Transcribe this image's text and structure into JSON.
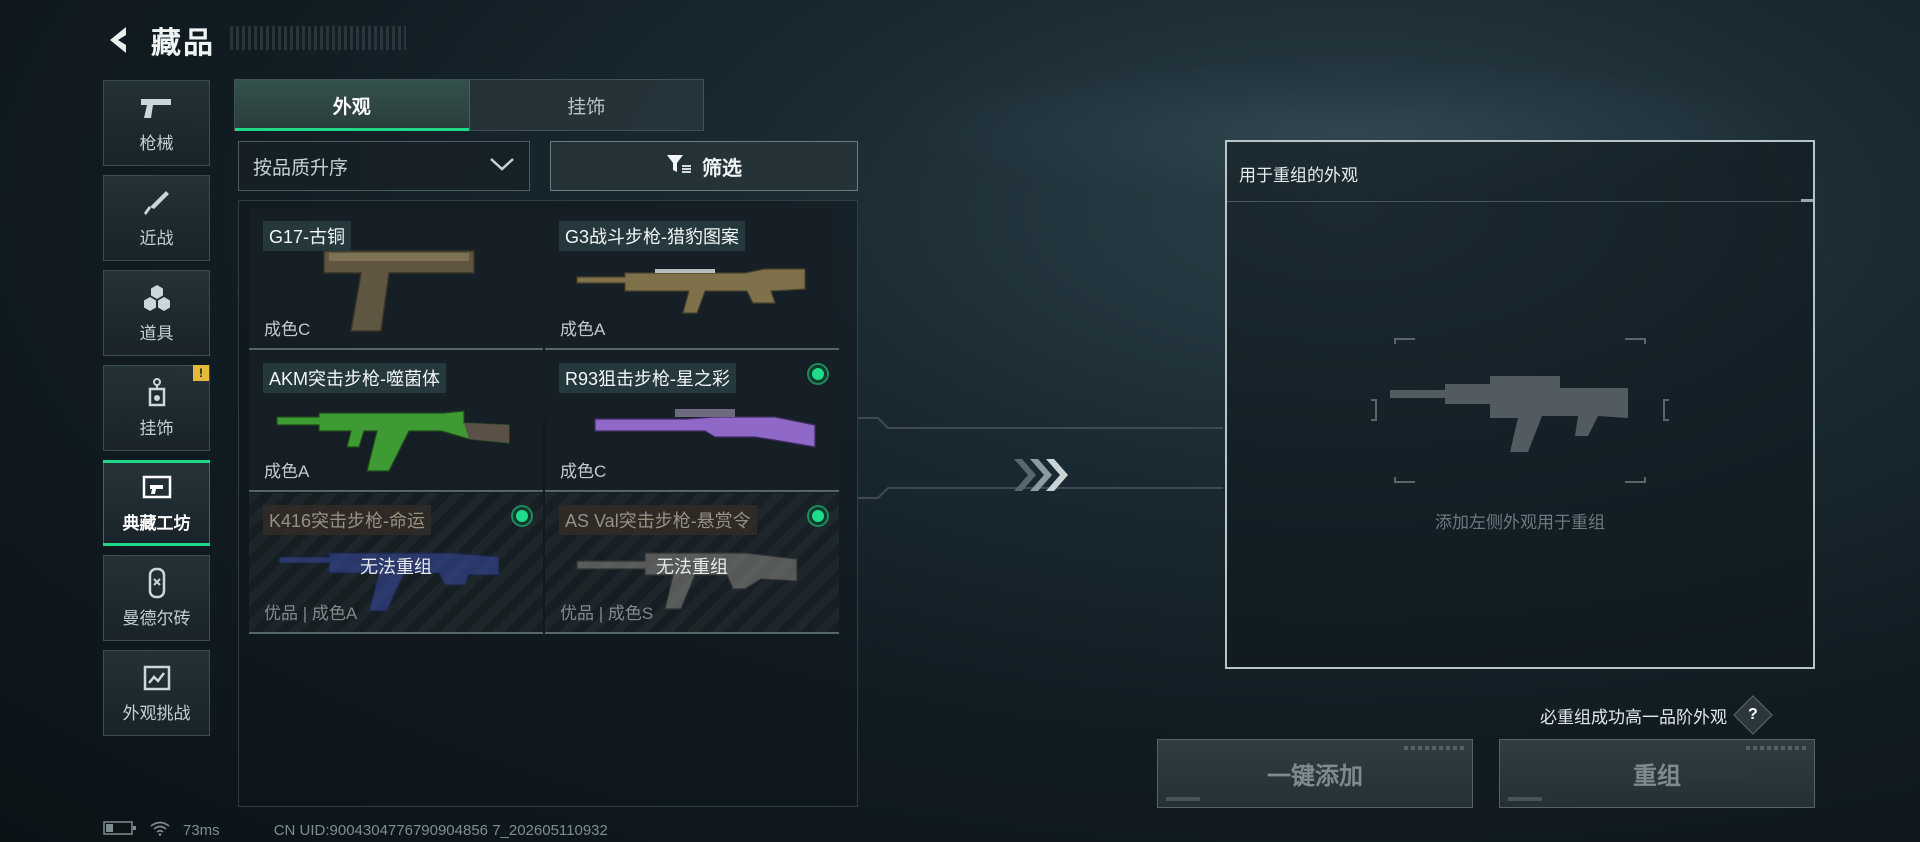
{
  "header": {
    "title": "藏品",
    "back_icon": "back-arrow-icon"
  },
  "categories": [
    {
      "label": "枪械",
      "icon": "pistol-icon",
      "active": false
    },
    {
      "label": "近战",
      "icon": "knife-icon",
      "active": false
    },
    {
      "label": "道具",
      "icon": "hexagon-cluster-icon",
      "active": false
    },
    {
      "label": "挂饰",
      "icon": "charm-tag-icon",
      "active": false,
      "badge": "!"
    },
    {
      "label": "典藏工坊",
      "icon": "workshop-icon",
      "active": true
    },
    {
      "label": "曼德尔砖",
      "icon": "brick-icon",
      "active": false
    },
    {
      "label": "外观挑战",
      "icon": "challenge-icon",
      "active": false
    }
  ],
  "tabs": [
    {
      "label": "外观",
      "active": true
    },
    {
      "label": "挂饰",
      "active": false
    }
  ],
  "sort": {
    "value": "按品质升序",
    "icon": "chevron-down-icon"
  },
  "filter": {
    "label": "筛选",
    "icon": "filter-icon"
  },
  "items": [
    {
      "name": "G17-古铜",
      "condition": "成色C",
      "weapon": "pistol",
      "color": "#6a5e44",
      "selected_dot": false,
      "disabled": false
    },
    {
      "name": "G3战斗步枪-猎豹图案",
      "condition": "成色A",
      "weapon": "rifle",
      "color": "#8a7a50",
      "selected_dot": false,
      "disabled": false
    },
    {
      "name": "AKM突击步枪-噬菌体",
      "condition": "成色A",
      "weapon": "ak",
      "color": "#3fa33a",
      "selected_dot": false,
      "disabled": false
    },
    {
      "name": "R93狙击步枪-星之彩",
      "condition": "成色C",
      "weapon": "sniper",
      "color": "#9a6fd0",
      "selected_dot": true,
      "disabled": false
    },
    {
      "name": "K416突击步枪-命运",
      "condition": "优品 | 成色A",
      "weapon": "m4",
      "color": "#3d4fb0",
      "selected_dot": true,
      "disabled": true,
      "unavailable": "无法重组"
    },
    {
      "name": "AS Val突击步枪-悬赏令",
      "condition": "优品 | 成色S",
      "weapon": "asval",
      "color": "#8c8c86",
      "selected_dot": true,
      "disabled": true,
      "unavailable": "无法重组"
    }
  ],
  "remix_panel": {
    "title": "用于重组的外观",
    "hint": "添加左侧外观用于重组",
    "placeholder_icon": "rifle-silhouette-icon"
  },
  "guarantee_hint": "必重组成功高一品阶外观",
  "help_label": "?",
  "buttons": {
    "add_all": "一键添加",
    "remix": "重组"
  },
  "status": {
    "ping": "73ms",
    "uid": "CN UID:9004304776790904856 7_202605110932"
  }
}
